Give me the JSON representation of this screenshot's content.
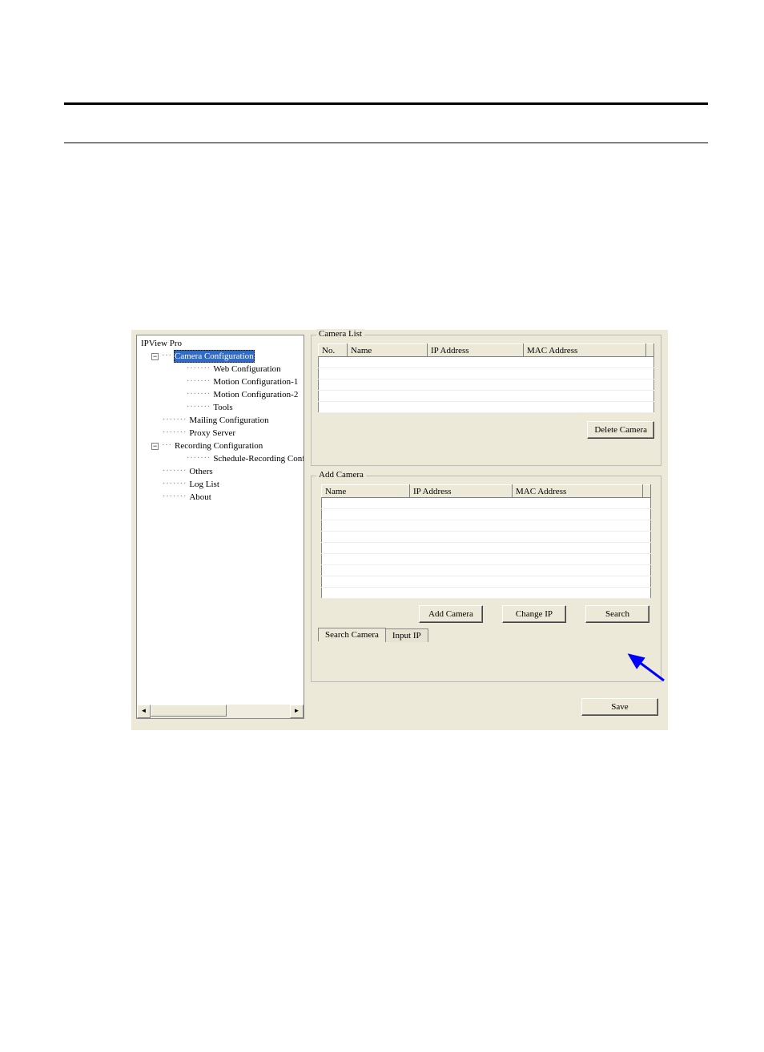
{
  "tree": {
    "root": "IPView Pro",
    "items": [
      {
        "label": "Camera Configuration",
        "selected": true,
        "children": [
          "Web Configuration",
          "Motion Configuration-1",
          "Motion Configuration-2",
          "Tools"
        ]
      },
      {
        "label": "Mailing Configuration"
      },
      {
        "label": "Proxy Server"
      },
      {
        "label": "Recording Configuration",
        "children": [
          "Schedule-Recording Configu"
        ]
      },
      {
        "label": "Others"
      },
      {
        "label": "Log List"
      },
      {
        "label": "About"
      }
    ]
  },
  "cameralist": {
    "title": "Camera List",
    "cols": {
      "no": "No.",
      "name": "Name",
      "ip": "IP Address",
      "mac": "MAC Address"
    },
    "delete_btn": "Delete Camera"
  },
  "addcamera": {
    "title": "Add Camera",
    "cols": {
      "name": "Name",
      "ip": "IP Address",
      "mac": "MAC Address"
    },
    "add_btn": "Add Camera",
    "changeip_btn": "Change IP",
    "search_btn": "Search",
    "tab_search": "Search Camera",
    "tab_input": "Input IP"
  },
  "save_btn": "Save",
  "scroll": {
    "left": "◄",
    "right": "►"
  }
}
